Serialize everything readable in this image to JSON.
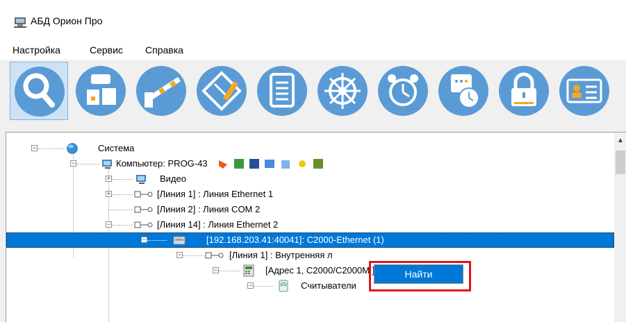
{
  "window": {
    "title": "АБД Орион Про"
  },
  "menu": [
    "Настройка",
    "Сервис",
    "Справка"
  ],
  "toolbar": {
    "buttons": [
      {
        "icon": "search-icon"
      },
      {
        "icon": "devices-icon"
      },
      {
        "icon": "barrier-icon"
      },
      {
        "icon": "floor-plan-edit-icon"
      },
      {
        "icon": "document-list-icon"
      },
      {
        "icon": "helm-icon"
      },
      {
        "icon": "alarm-clock-icon"
      },
      {
        "icon": "schedule-icon"
      },
      {
        "icon": "lock-icon"
      },
      {
        "icon": "user-card-icon"
      }
    ]
  },
  "tree": {
    "root": "Система",
    "computer": "Компьютер: PROG-43",
    "video": "Видео",
    "line1": "[Линия 1] : Линия Ethernet 1",
    "line2": "[Линия 2] : Линия COM 2",
    "line14": "[Линия 14] : Линия Ethernet 2",
    "device": "[192.168.203.41:40041]: C2000-Ethernet (1)",
    "inner_line": "[Линия 1] : Внутренняя л",
    "address": "[Адрес 1, C2000/C2000M ]: C2000/C2000M (1)",
    "readers": "Считыватели"
  },
  "context_menu": {
    "find_label": "Найти"
  },
  "colors": {
    "selection": "#0078d7",
    "highlight_outline": "#e0141c",
    "toolbar_icon_bg": "#5b9bd5"
  }
}
